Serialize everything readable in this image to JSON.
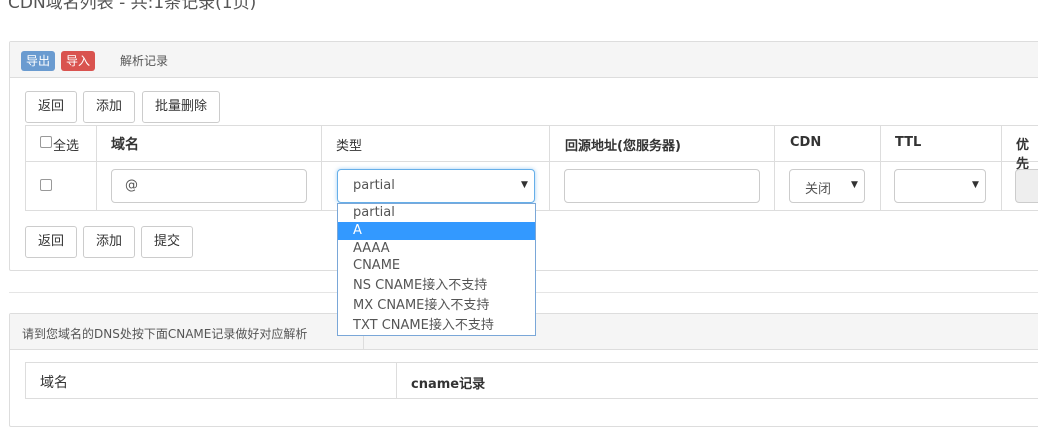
{
  "page_title": "CDN域名列表 - 共:1条记录(1页)",
  "toolbar": {
    "export_label": "导出",
    "import_label": "导入",
    "tab_label": "解析记录"
  },
  "actions_top": {
    "back_label": "返回",
    "add_label": "添加",
    "batch_delete_label": "批量删除"
  },
  "table": {
    "headers": {
      "select_all": "全选",
      "domain": "域名",
      "type": "类型",
      "origin": "回源地址(您服务器)",
      "cdn": "CDN",
      "ttl": "TTL",
      "priority": "优先"
    },
    "row": {
      "domain_value": "@",
      "type_value": "partial",
      "origin_value": "",
      "cdn_value": "关闭",
      "ttl_value": ""
    }
  },
  "type_options": [
    "partial",
    "A",
    "AAAA",
    "CNAME",
    "NS CNAME接入不支持",
    "MX CNAME接入不支持",
    "TXT CNAME接入不支持"
  ],
  "type_highlighted_option": "A",
  "actions_bottom": {
    "back_label": "返回",
    "add_label": "添加",
    "submit_label": "提交"
  },
  "cname_panel": {
    "hint": "请到您域名的DNS处按下面CNAME记录做好对应解析",
    "headers": {
      "domain": "域名",
      "cname": "cname记录"
    }
  },
  "colors": {
    "export_button": "#6a9bd0",
    "import_button": "#d9534f",
    "highlight": "#3399ff",
    "border": "#dddddd"
  }
}
